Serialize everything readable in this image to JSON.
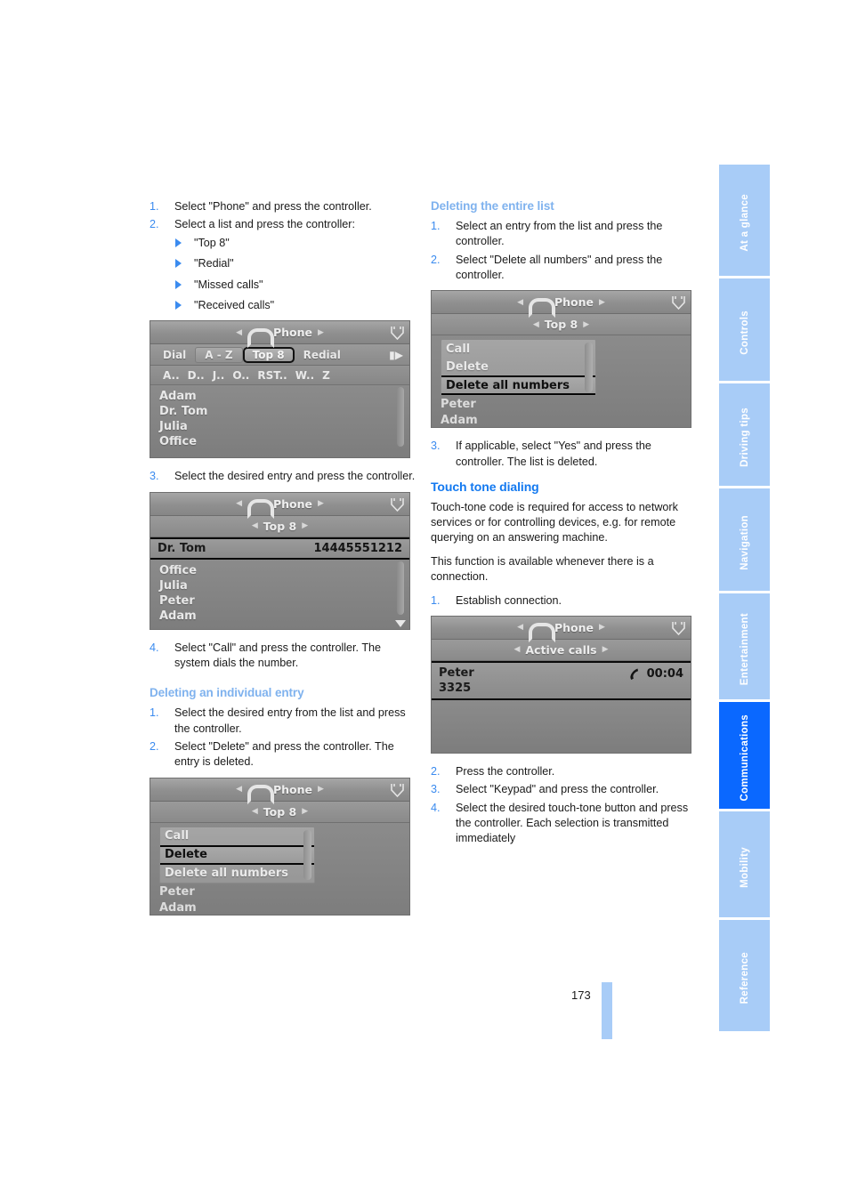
{
  "document": {
    "page_number": "173"
  },
  "sidebar": {
    "chapters": [
      {
        "label": "At a glance",
        "active": false
      },
      {
        "label": "Controls",
        "active": false
      },
      {
        "label": "Driving tips",
        "active": false
      },
      {
        "label": "Navigation",
        "active": false
      },
      {
        "label": "Entertainment",
        "active": false
      },
      {
        "label": "Communications",
        "active": true
      },
      {
        "label": "Mobility",
        "active": false
      },
      {
        "label": "Reference",
        "active": false
      }
    ],
    "active_color": "#0A68FF",
    "inactive_color": "#A8CCF7"
  },
  "left_column": {
    "steps_top": [
      {
        "num": "1.",
        "text": "Select \"Phone\" and press the controller."
      },
      {
        "num": "2.",
        "text": "Select a list and press the controller:"
      }
    ],
    "list_options": [
      "\"Top 8\"",
      "\"Redial\"",
      "\"Missed calls\"",
      "\"Received calls\""
    ],
    "step3": {
      "num": "3.",
      "text": "Select the desired entry and press the controller."
    },
    "step4": {
      "num": "4.",
      "text": "Select \"Call\" and press the controller. The system dials the number."
    },
    "heading_delete_individual": "Deleting an individual entry",
    "delete_individual_steps": [
      {
        "num": "1.",
        "text": "Select the desired entry from the list and press the controller."
      },
      {
        "num": "2.",
        "text": "Select \"Delete\" and press the controller. The entry is deleted."
      }
    ]
  },
  "right_column": {
    "heading_delete_list": "Deleting the entire list",
    "delete_list_steps": [
      {
        "num": "1.",
        "text": "Select an entry from the list and press the controller."
      },
      {
        "num": "2.",
        "text": "Select \"Delete all numbers\" and press the controller."
      }
    ],
    "step3_yes": {
      "num": "3.",
      "text": "If applicable, select \"Yes\" and press the controller. The list is deleted."
    },
    "heading_touch_tone": "Touch tone dialing",
    "para_touch_tone_1": "Touch-tone code is required for access to network services or for controlling devices, e.g. for remote querying on an answering machine.",
    "para_touch_tone_2": "This function is available whenever there is a connection.",
    "step_establish": {
      "num": "1.",
      "text": "Establish connection."
    },
    "final_steps": [
      {
        "num": "2.",
        "text": "Press the controller."
      },
      {
        "num": "3.",
        "text": "Select \"Keypad\" and press the controller."
      },
      {
        "num": "4.",
        "text": "Select the desired touch-tone button and press the controller. Each selection is transmitted immediately"
      }
    ]
  },
  "screens": {
    "phone_az": {
      "title": "Phone",
      "tabs": [
        {
          "label": "Dial",
          "style": "plain"
        },
        {
          "label": "A - Z",
          "style": "raised"
        },
        {
          "label": "Top 8",
          "style": "selected"
        },
        {
          "label": "Redial",
          "style": "plain"
        }
      ],
      "more_glyph": "▮▶",
      "letters": [
        "A..",
        "D..",
        "J..",
        "O..",
        "RST..",
        "W..",
        "Z"
      ],
      "entries": [
        "Adam",
        "Dr. Tom",
        "Julia",
        "Office"
      ]
    },
    "phone_top8": {
      "title": "Phone",
      "subtitle": "Top 8",
      "selected_entry": {
        "name": "Dr. Tom",
        "number": "14445551212"
      },
      "entries": [
        "Office",
        "Julia",
        "Peter",
        "Adam"
      ]
    },
    "phone_menu_delete": {
      "title": "Phone",
      "subtitle": "Top 8",
      "menu": [
        {
          "label": "Call",
          "selected": false
        },
        {
          "label": "Delete",
          "selected": true
        },
        {
          "label": "Delete all numbers",
          "selected": false
        }
      ],
      "behind_entries": [
        "Peter",
        "Adam"
      ]
    },
    "phone_menu_delete_all": {
      "title": "Phone",
      "subtitle": "Top 8",
      "menu": [
        {
          "label": "Call",
          "selected": false
        },
        {
          "label": "Delete",
          "selected": false
        },
        {
          "label": "Delete all numbers",
          "selected": true
        }
      ],
      "behind_entries": [
        "Peter",
        "Adam"
      ]
    },
    "phone_active_call": {
      "title": "Phone",
      "subtitle": "Active calls",
      "caller_name": "Peter",
      "caller_number": "3325",
      "duration": "00:04"
    }
  }
}
